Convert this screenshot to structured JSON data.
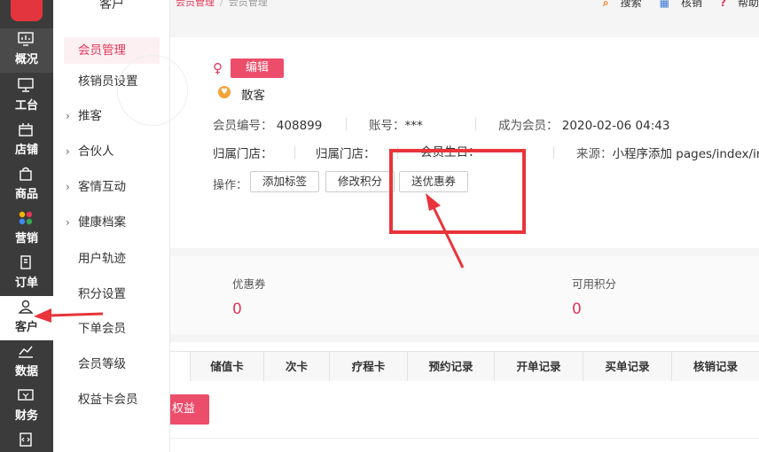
{
  "nav": {
    "items": [
      {
        "label": "概况",
        "icon": "monitor-chart-icon"
      },
      {
        "label": "工台",
        "icon": "desktop-icon"
      },
      {
        "label": "店铺",
        "icon": "store-icon"
      },
      {
        "label": "商品",
        "icon": "bag-icon"
      },
      {
        "label": "营销",
        "icon": "apps-icon"
      },
      {
        "label": "订单",
        "icon": "order-icon"
      },
      {
        "label": "客户",
        "icon": "user-icon"
      },
      {
        "label": "数据",
        "icon": "chart-icon"
      },
      {
        "label": "财务",
        "icon": "finance-icon"
      }
    ]
  },
  "subnav": {
    "title": "客户",
    "items": [
      {
        "label": "会员管理"
      },
      {
        "label": "核销员设置"
      },
      {
        "label": "推客"
      },
      {
        "label": "合伙人"
      },
      {
        "label": "客情互动"
      },
      {
        "label": "健康档案"
      },
      {
        "label": "用户轨迹"
      },
      {
        "label": "积分设置"
      },
      {
        "label": "下单会员"
      },
      {
        "label": "会员等级"
      },
      {
        "label": "权益卡会员"
      }
    ]
  },
  "breadcrumb": {
    "link": "会员管理",
    "sep": "/",
    "current": "会员管理"
  },
  "top_actions": {
    "search": "搜索",
    "verify": "核销",
    "help": "帮助"
  },
  "member": {
    "gender": "♀",
    "edit_label": "编辑",
    "level": "散客",
    "id_label": "会员编号：",
    "id_value": "408899",
    "account_label": "账号：",
    "account_value": "***",
    "join_label": "成为会员：",
    "join_value": "2020-02-06 04:43",
    "store_label1": "归属门店：",
    "store_label2": "归属门店：",
    "birthday_label": "会员生日：",
    "source_label": "来源：",
    "source_value": "小程序添加 pages/index/index",
    "ops_label": "操作：",
    "btn_add_tag": "添加标签",
    "btn_edit_points": "修改积分",
    "btn_send_coupon": "送优惠券"
  },
  "stats": {
    "coupon_label": "优惠券",
    "coupon_value": "0",
    "points_label": "可用积分",
    "points_value": "0"
  },
  "tabs": [
    "储值卡",
    "次卡",
    "疗程卡",
    "预约记录",
    "开单记录",
    "买单记录",
    "核销记录"
  ],
  "card_btn": "权益卡",
  "colors": {
    "accent": "#e3365a",
    "annotation": "#e8343a",
    "sidebar": "#3b3b3b"
  }
}
